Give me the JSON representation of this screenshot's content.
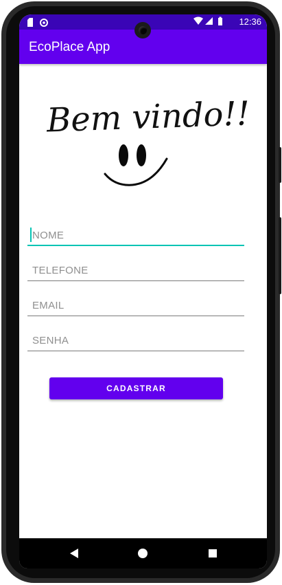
{
  "status_bar": {
    "time": "12:36",
    "icons": [
      "sd-card-icon",
      "sync-icon",
      "wifi-icon",
      "cell-signal-icon",
      "battery-icon"
    ]
  },
  "app_bar": {
    "title": "EcoPlace App",
    "color": "#6200ee"
  },
  "hero": {
    "greeting": "Bem vindo!!"
  },
  "form": {
    "fields": [
      {
        "label": "NOME",
        "focused": true
      },
      {
        "label": "TELEFONE"
      },
      {
        "label": "EMAIL"
      },
      {
        "label": "SENHA"
      }
    ],
    "submit_label": "CADASTRAR"
  },
  "nav_bar": {
    "icons": [
      "back-icon",
      "home-icon",
      "recents-icon"
    ]
  },
  "colors": {
    "primary": "#6200ee",
    "primary_dark": "#3700b3",
    "accent": "#03dac5"
  }
}
